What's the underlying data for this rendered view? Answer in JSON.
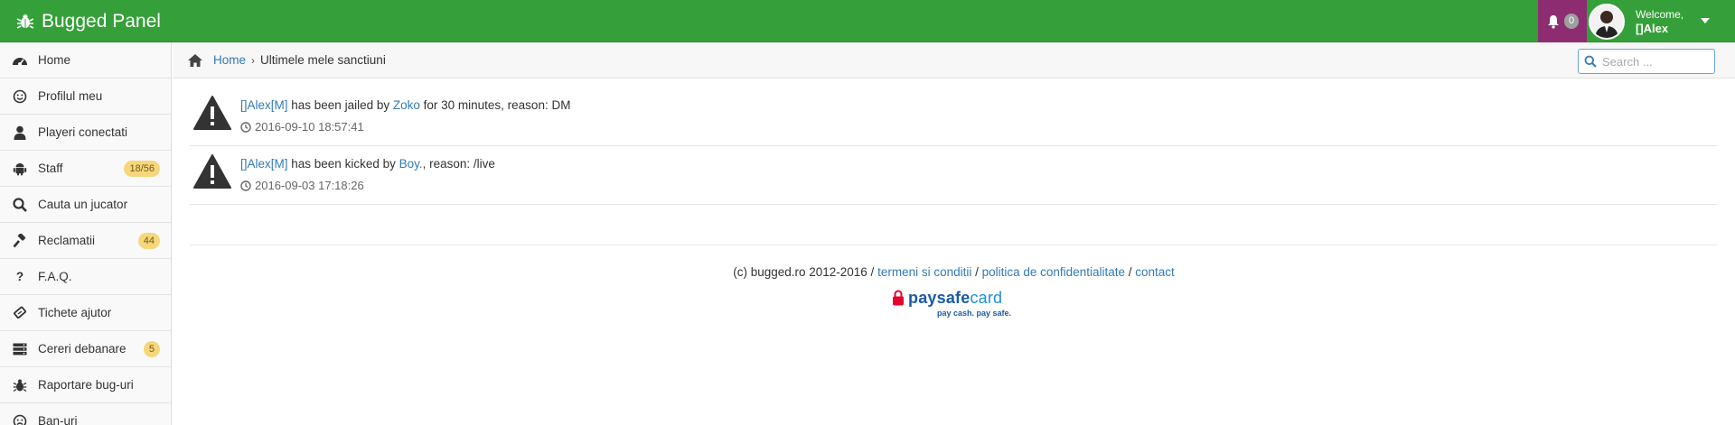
{
  "app": {
    "brand_title": "Bugged Panel",
    "brand_icon": "bug-icon"
  },
  "header": {
    "notifications_count": "0",
    "welcome_label": "Welcome,",
    "user_name": "[]Alex",
    "colors": {
      "topbar": "#35a039",
      "notifications_bg": "#8e2c72"
    }
  },
  "sidebar": {
    "items": [
      {
        "label": "Home",
        "icon": "dashboard-icon"
      },
      {
        "label": "Profilul meu",
        "icon": "smile-icon"
      },
      {
        "label": "Playeri conectati",
        "icon": "user-icon"
      },
      {
        "label": "Staff",
        "icon": "android-icon",
        "badge": "18/56"
      },
      {
        "label": "Cauta un jucator",
        "icon": "search-icon"
      },
      {
        "label": "Reclamatii",
        "icon": "gavel-icon",
        "badge": "44"
      },
      {
        "label": "F.A.Q.",
        "icon": "question-icon"
      },
      {
        "label": "Tichete ajutor",
        "icon": "ticket-icon"
      },
      {
        "label": "Cereri debanare",
        "icon": "server-icon",
        "badge": "5"
      },
      {
        "label": "Raportare bug-uri",
        "icon": "bug-icon"
      },
      {
        "label": "Ban-uri",
        "icon": "frown-icon"
      }
    ]
  },
  "breadcrumb": {
    "home_label": "Home",
    "separator": "›",
    "current": "Ultimele mele sanctiuni"
  },
  "search": {
    "placeholder": "Search ..."
  },
  "logs": [
    {
      "player": "[]Alex[M]",
      "action_text": " has been jailed by ",
      "admin": "Zoko",
      "details": " for 30 minutes, reason: DM",
      "timestamp": "2016-09-10 18:57:41"
    },
    {
      "player": "[]Alex[M]",
      "action_text": " has been kicked by ",
      "admin": "Boy.",
      "details": ", reason: /live",
      "timestamp": "2016-09-03 17:18:26"
    }
  ],
  "footer": {
    "copyright": "(c) bugged.ro 2012-2016 / ",
    "terms_link": "termeni si conditii",
    "sep1": " / ",
    "privacy_link": "politica de confidentialitate",
    "sep2": " / ",
    "contact_link": "contact"
  },
  "paysafe": {
    "brand_main": "paysafe",
    "brand_card": "card",
    "tagline": "pay cash. pay safe."
  }
}
